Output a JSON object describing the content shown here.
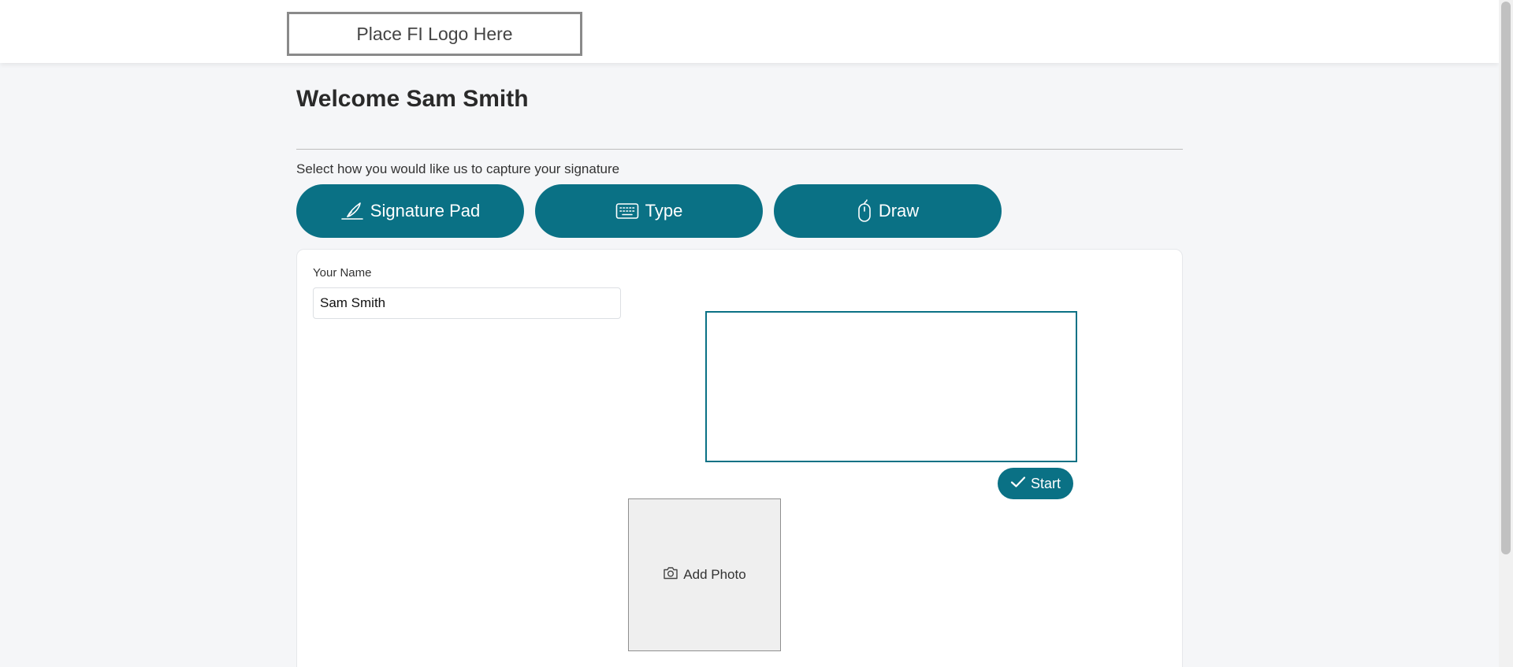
{
  "header": {
    "logo_text": "Place FI Logo Here"
  },
  "main": {
    "welcome": "Welcome Sam Smith",
    "instruction": "Select how you would like us to capture your signature",
    "methods": [
      {
        "label": "Signature Pad",
        "icon": "pen-nib-icon"
      },
      {
        "label": "Type",
        "icon": "keyboard-icon"
      },
      {
        "label": "Draw",
        "icon": "mouse-icon"
      }
    ]
  },
  "form": {
    "name_label": "Your Name",
    "name_value": "Sam Smith",
    "start_label": "Start",
    "start_icon": "check-icon",
    "photo_label": "Add Photo",
    "photo_icon": "camera-icon"
  },
  "colors": {
    "accent": "#0a7185",
    "page_bg": "#f5f6f8"
  }
}
